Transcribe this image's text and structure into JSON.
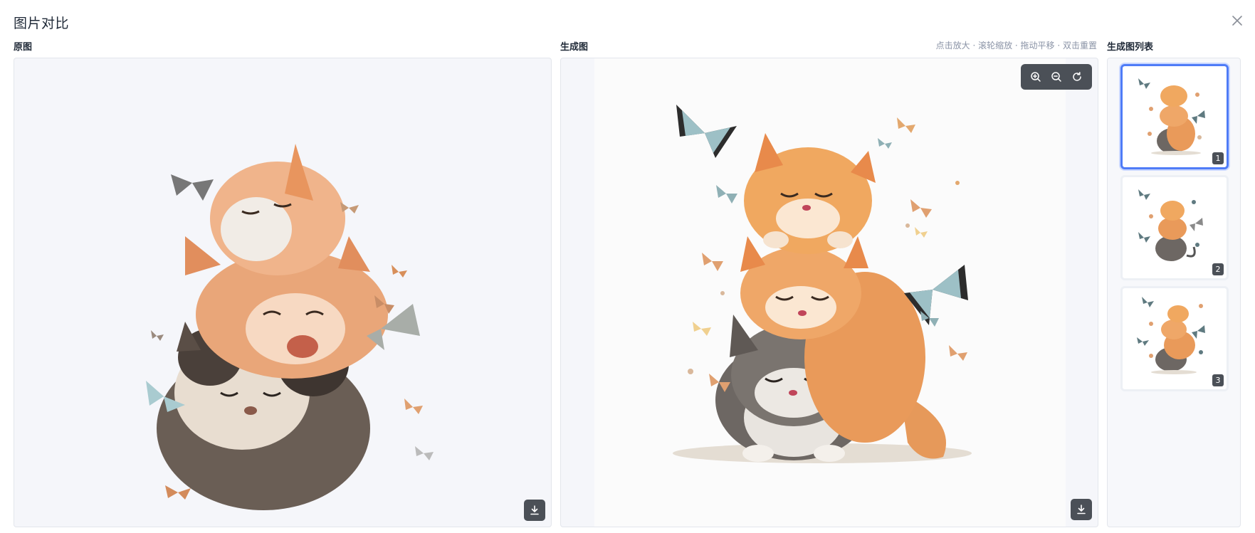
{
  "dialog": {
    "title": "图片对比",
    "close_icon": "close-icon"
  },
  "original": {
    "label": "原图",
    "download_icon": "download-icon"
  },
  "generated": {
    "label": "生成图",
    "hint": "点击放大 · 滚轮缩放 · 拖动平移 · 双击重置",
    "toolbar": [
      "zoom-in-icon",
      "zoom-out-icon",
      "reset-icon"
    ],
    "download_icon": "download-icon"
  },
  "gallery": {
    "label": "生成图列表",
    "items": [
      {
        "index": "1",
        "active": true
      },
      {
        "index": "2",
        "active": false
      },
      {
        "index": "3",
        "active": false
      }
    ]
  },
  "colors": {
    "accent": "#4f7cf7",
    "panel_bg": "#f5f6fa",
    "toolbar_bg": "#4b5057",
    "hint_text": "#8a93a6"
  }
}
